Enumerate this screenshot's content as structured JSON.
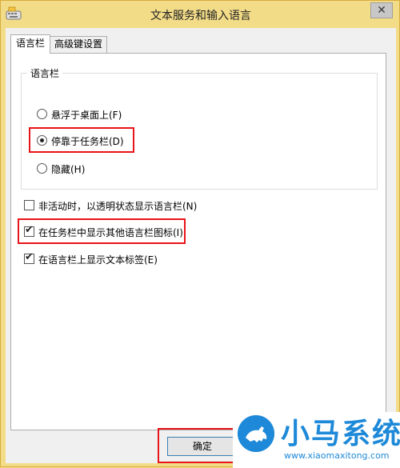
{
  "window": {
    "title": "文本服务和输入语言",
    "close_label": "✕"
  },
  "tabs": [
    {
      "label": "语言栏",
      "active": true
    },
    {
      "label": "高级键设置",
      "active": false
    }
  ],
  "language_bar_group": {
    "title": "语言栏",
    "options": [
      {
        "label": "悬浮于桌面上(F)",
        "checked": false
      },
      {
        "label": "停靠于任务栏(D)",
        "checked": true
      },
      {
        "label": "隐藏(H)",
        "checked": false
      }
    ]
  },
  "checkboxes": [
    {
      "label": "非活动时，以透明状态显示语言栏(N)",
      "checked": false
    },
    {
      "label": "在任务栏中显示其他语言栏图标(I)",
      "checked": true
    },
    {
      "label": "在语言栏上显示文本标签(E)",
      "checked": true
    }
  ],
  "ok_button": {
    "label": "确定"
  },
  "highlight_color": "#e8141a",
  "watermark": {
    "title": "小马系统",
    "url": "www.xiaomaxitong.com",
    "color": "#1d89d8"
  }
}
